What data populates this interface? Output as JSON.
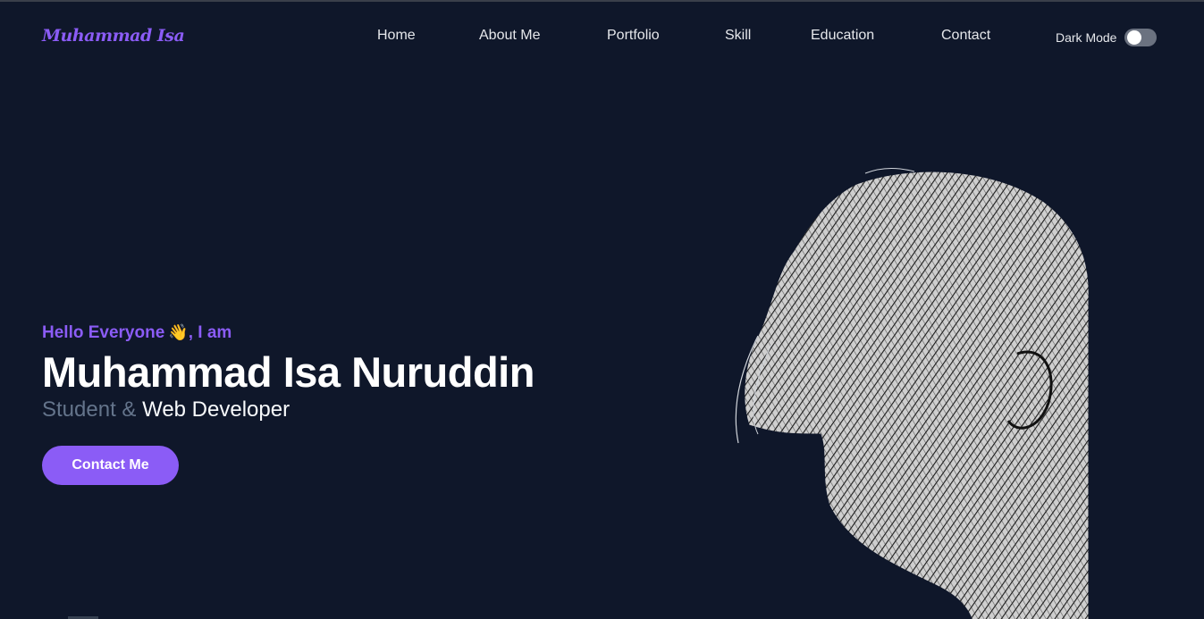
{
  "brand": {
    "logo": "Muhammad Isa",
    "accent": "#8b5cf6",
    "background": "#0f172a"
  },
  "nav": {
    "items": [
      {
        "label": "Home"
      },
      {
        "label": "About Me"
      },
      {
        "label": "Portfolio"
      },
      {
        "label": "Skill"
      },
      {
        "label": "Education"
      },
      {
        "label": "Contact"
      }
    ],
    "dark_mode_label": "Dark Mode",
    "dark_mode_on": false
  },
  "hero": {
    "greeting_prefix": "Hello Everyone",
    "greeting_emoji": "👋",
    "greeting_suffix": ", I am",
    "name": "Muhammad Isa Nuruddin",
    "role_muted": "Student &",
    "role_strong": "Web Developer",
    "cta_label": "Contact Me"
  },
  "icons": {
    "wave": "waving-hand-icon"
  }
}
